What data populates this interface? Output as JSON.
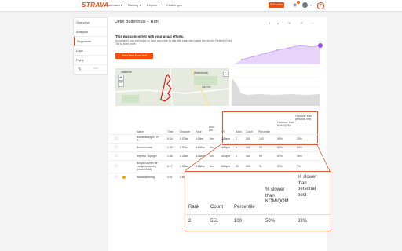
{
  "nav": {
    "logo": "STRAVA",
    "items": [
      "Dashboard ▾",
      "Training ▾",
      "Explore ▾",
      "Challenges"
    ],
    "subscribe": "Subscribe",
    "notification_count": "3"
  },
  "sidebar": {
    "items": [
      "Overview",
      "Analysis",
      "Segments",
      "Laps",
      "Flyby"
    ],
    "active": "Segments"
  },
  "page": {
    "title": "Jelle Buitenhuis – Run"
  },
  "upsell": {
    "heading": "This was consistent with your usual efforts.",
    "description": "Know when your training is on track and when to rest with heart rate-based metrics like Relative Effort. Tap to learn more.",
    "button": "Start Your Free Trial"
  },
  "map": {
    "place_1": "Valkeride",
    "place_2": "Westerbroek",
    "place_3": "Lammer"
  },
  "table": {
    "headers": [
      "Name",
      "Time",
      "Distance",
      "Pace",
      "Elev Diff",
      "HR",
      "Rank",
      "Count",
      "Percentile",
      "% slower than KOM/QOM",
      "% slower than personal best"
    ],
    "rows": [
      {
        "name": "Bonderlaang 67 0+ R.",
        "time": "0:24",
        "distance": "0.07km",
        "pace": "4:0/km",
        "elev": "0m",
        "hr": "158bpm",
        "rank": "2",
        "count": "551",
        "percentile": "100",
        "kom": "50%",
        "pb": "33%"
      },
      {
        "name": "Bremenmoen",
        "time": "1:32",
        "distance": "0.37km",
        "pace": "4:10/km",
        "elev": "4m",
        "hr": "168bpm",
        "rank": "4",
        "count": "442",
        "percentile": "99",
        "kom": "60%",
        "pb": "63%"
      },
      {
        "name": "Represt - Spegel",
        "time": "1:38",
        "distance": "0.28km",
        "pace": "4:18/km",
        "elev": "4m",
        "hr": "163bpm",
        "rank": "3",
        "count": "462",
        "percentile": "99",
        "kom": "67%",
        "pb": "45%"
      },
      {
        "name": "Boxpad achter de Langeklampweg (Noord-Zuid)",
        "time": "6:17",
        "distance": "1.52km",
        "pace": "4:08/km",
        "elev": "6m",
        "hr": "160bpm",
        "rank": "39",
        "count": "660",
        "percentile": "91",
        "kom": "52%",
        "pb": "7%"
      },
      {
        "name": "Waldstatekmeg",
        "time": "4:51",
        "distance": "0.86km",
        "pace": "4:04/km",
        "elev": "4m",
        "hr": "161bpm",
        "rank": "",
        "count": "",
        "percentile": "",
        "kom": "",
        "pb": ""
      }
    ]
  },
  "zoom": {
    "headers": [
      "Rank",
      "Count",
      "Percentile",
      "% slower than KOM/QOM",
      "% slower than personal best"
    ],
    "values": [
      "2",
      "551",
      "100",
      "50%",
      "33%"
    ]
  },
  "colors": {
    "accent": "#fc4c02",
    "highlight": "#e05b36",
    "chart": "#c69af0"
  }
}
